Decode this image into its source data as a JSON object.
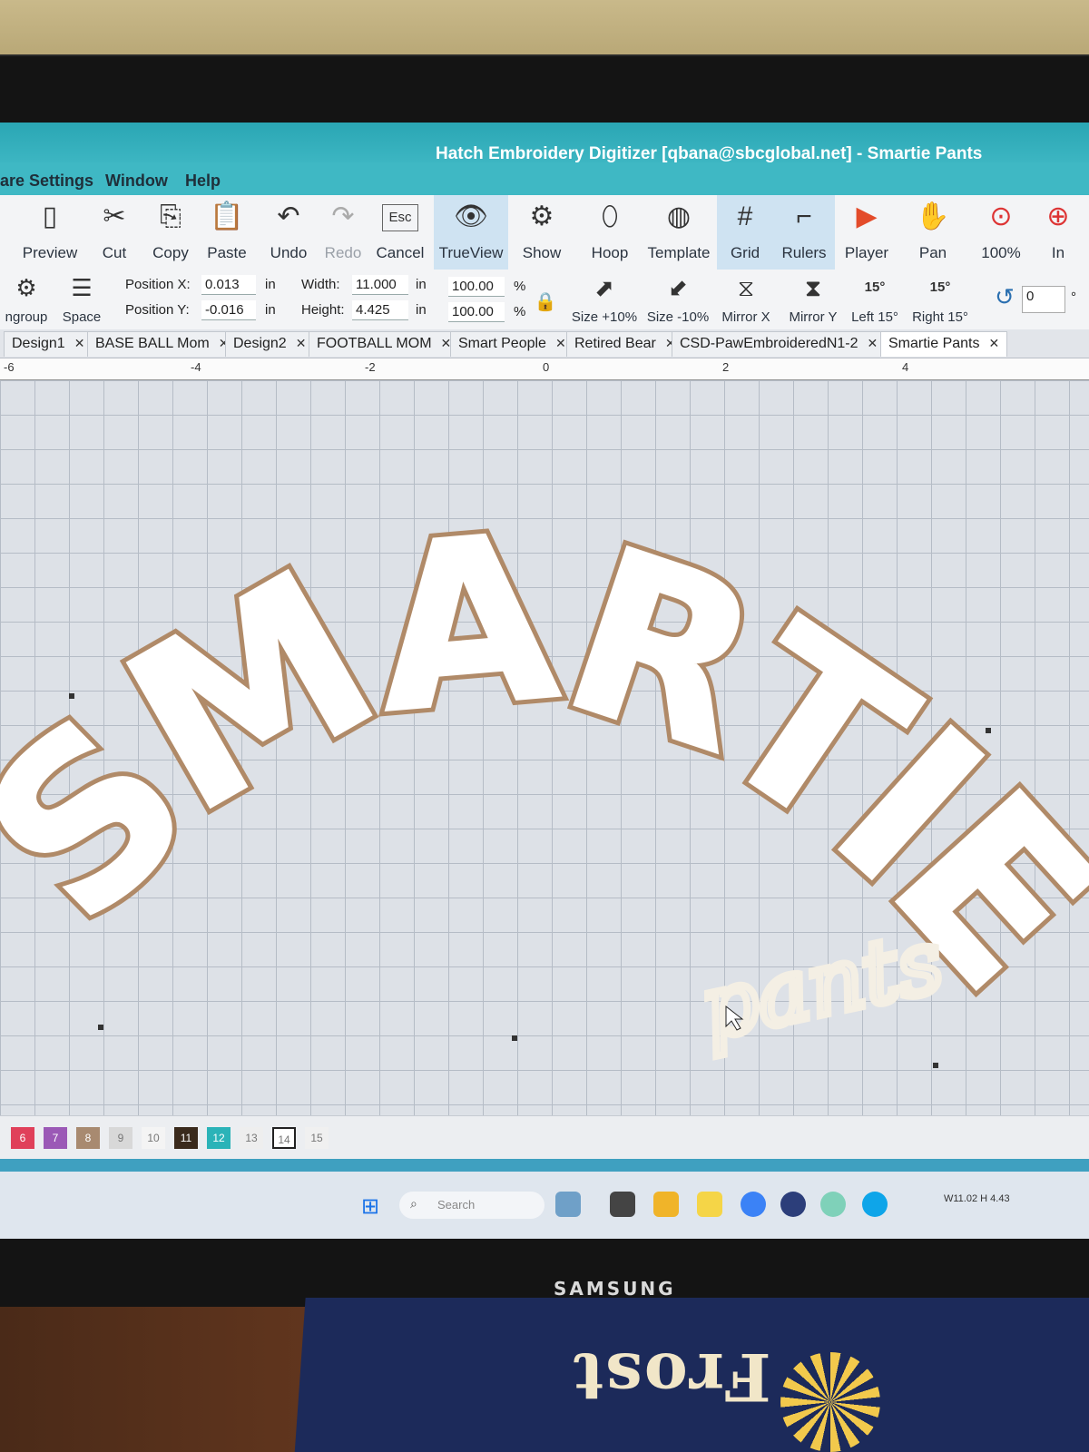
{
  "window": {
    "title": "Hatch Embroidery Digitizer [qbana@sbcglobal.net] - Smartie Pants"
  },
  "menu": [
    "are Settings",
    "Window",
    "Help"
  ],
  "ribbon": {
    "buttons": [
      "Preview",
      "Cut",
      "Copy",
      "Paste",
      "Undo",
      "Redo",
      "Cancel",
      "TrueView",
      "Show",
      "Hoop",
      "Template",
      "Grid",
      "Rulers",
      "Player",
      "Pan",
      "100%",
      "In"
    ],
    "esc_key": "Esc"
  },
  "ribbon2": {
    "ungroup": "ngroup",
    "space": "Space",
    "pos_x_label": "Position X:",
    "pos_y_label": "Position Y:",
    "pos_x": "0.013",
    "pos_y": "-0.016",
    "unit": "in",
    "width_label": "Width:",
    "height_label": "Height:",
    "width": "11.000",
    "height": "4.425",
    "scale_w": "100.00",
    "scale_h": "100.00",
    "pct": "%",
    "tools": [
      "Size +10%",
      "Size -10%",
      "Mirror X",
      "Mirror Y",
      "Left 15°",
      "Right 15°"
    ],
    "rotate_deg": "15°",
    "rotate_value": "0",
    "degree": "°"
  },
  "tabs": [
    "Design1",
    "BASE BALL Mom",
    "Design2",
    "FOOTBALL MOM",
    "Smart People",
    "Retired Bear",
    "CSD-PawEmbroideredN1-2",
    "Smartie Pants"
  ],
  "ruler": [
    "-6",
    "-4",
    "-2",
    "0",
    "2",
    "4"
  ],
  "design": {
    "main_text": "SMARTIE",
    "script_text": "pants",
    "main_color": "#b08a68",
    "script_color": "#f4efe4"
  },
  "colorbar": [
    {
      "n": "6",
      "c": "#e0405a"
    },
    {
      "n": "7",
      "c": "#9b59b6"
    },
    {
      "n": "8",
      "c": "#a88a70"
    },
    {
      "n": "9",
      "c": "#d8d8d8"
    },
    {
      "n": "10",
      "c": "#f4f4f4"
    },
    {
      "n": "11",
      "c": "#3a2a1c"
    },
    {
      "n": "12",
      "c": "#2bb3b8"
    },
    {
      "n": "13",
      "c": "#eeeeee"
    },
    {
      "n": "14",
      "c": "#ffffff"
    },
    {
      "n": "15",
      "c": "#f0f0f0"
    }
  ],
  "taskbar": {
    "search": "Search",
    "version": "W11.02 H 4.43"
  },
  "monitor": {
    "brand": "SAMSUNG"
  },
  "mat": {
    "text": "Frost"
  }
}
